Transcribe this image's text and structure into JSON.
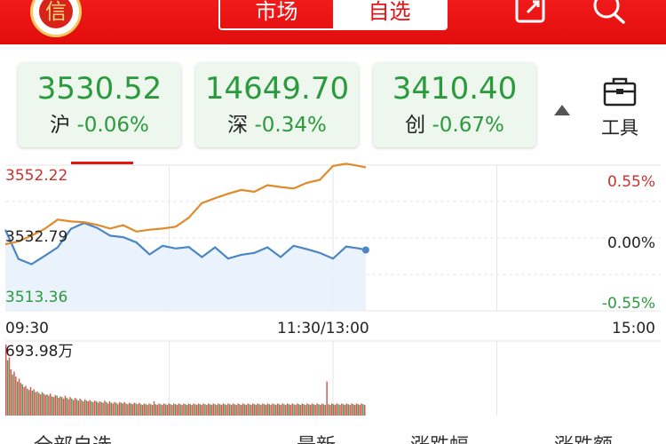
{
  "header": {
    "logo_text": "信",
    "tabs": [
      {
        "label": "市场",
        "active": false
      },
      {
        "label": "自选",
        "active": true
      }
    ],
    "icons": [
      "share-icon",
      "search-icon"
    ]
  },
  "indices": [
    {
      "value": "3530.52",
      "name": "沪",
      "change": "-0.06%"
    },
    {
      "value": "14649.70",
      "name": "深",
      "change": "-0.34%"
    },
    {
      "value": "3410.40",
      "name": "创",
      "change": "-0.67%"
    }
  ],
  "tools": {
    "label": "工具",
    "icon": "toolbox-icon"
  },
  "chart": {
    "y_left": {
      "top": "3552.22",
      "mid": "3532.79",
      "bottom": "3513.36"
    },
    "y_right": {
      "top": "0.55%",
      "mid": "0.00%",
      "bottom": "-0.55%"
    },
    "time_labels": {
      "start": "09:30",
      "mid": "11:30/13:00",
      "end": "15:00"
    },
    "volume_label": "693.98万"
  },
  "bottom_bar": [
    "全部自选",
    "最新",
    "涨跌幅",
    "涨跌额"
  ],
  "colors": {
    "brand_red": "#e31414",
    "up_red": "#c7332d",
    "down_green": "#2a9a3c",
    "index_line": "#4a86c5",
    "avg_line": "#e08a2a"
  },
  "chart_data": {
    "type": "line",
    "ylim": [
      3513.36,
      3552.22
    ],
    "x_progress": [
      0.0,
      0.02,
      0.04,
      0.06,
      0.08,
      0.1,
      0.12,
      0.14,
      0.16,
      0.18,
      0.2,
      0.22,
      0.24,
      0.26,
      0.28,
      0.3,
      0.32,
      0.34,
      0.36,
      0.38,
      0.4,
      0.42,
      0.44,
      0.46,
      0.48,
      0.5,
      0.52,
      0.54,
      0.55
    ],
    "series": [
      {
        "values": [
          3535.0,
          3527.2,
          3525.8,
          3528.0,
          3530.3,
          3535.2,
          3536.8,
          3535.5,
          3533.4,
          3533.0,
          3531.6,
          3528.4,
          3530.7,
          3530.0,
          3530.4,
          3527.7,
          3530.3,
          3527.3,
          3528.3,
          3528.8,
          3530.3,
          3527.7,
          3530.7,
          3529.8,
          3528.8,
          3527.3,
          3530.5,
          3530.0,
          3529.6
        ]
      },
      {
        "values": [
          3531.1,
          3531.9,
          3533.4,
          3535.2,
          3537.7,
          3537.2,
          3537.0,
          3536.3,
          3535.3,
          3536.2,
          3534.5,
          3535.0,
          3535.3,
          3535.8,
          3538.2,
          3542.1,
          3543.4,
          3544.6,
          3545.6,
          3545.1,
          3546.9,
          3546.4,
          3546.0,
          3547.5,
          3548.3,
          3552.0,
          3552.6,
          3552.0,
          3551.6
        ]
      }
    ],
    "volume": [
      1.0,
      0.78,
      0.82,
      0.65,
      0.58,
      0.62,
      0.55,
      0.48,
      0.52,
      0.46,
      0.44,
      0.4,
      0.42,
      0.38,
      0.36,
      0.4,
      0.35,
      0.37,
      0.33,
      0.34,
      0.32,
      0.3,
      0.33,
      0.31,
      0.29,
      0.3,
      0.28,
      0.31,
      0.27,
      0.26,
      0.29,
      0.28,
      0.25,
      0.27,
      0.26,
      0.24,
      0.28,
      0.25,
      0.23,
      0.26,
      0.24,
      0.22,
      0.25,
      0.23,
      0.21,
      0.24,
      0.22,
      0.2,
      0.23,
      0.21,
      0.2,
      0.22,
      0.2,
      0.19,
      0.21,
      0.2,
      0.18,
      0.2,
      0.19,
      0.18,
      0.21,
      0.19,
      0.17,
      0.2,
      0.18,
      0.17,
      0.19,
      0.18,
      0.16,
      0.19,
      0.18,
      0.17,
      0.19,
      0.17,
      0.16,
      0.18,
      0.17,
      0.16,
      0.18,
      0.17,
      0.16,
      0.18,
      0.16,
      0.15,
      0.17,
      0.16,
      0.15,
      0.17,
      0.16,
      0.15,
      0.2,
      0.16,
      0.15,
      0.17,
      0.16,
      0.15,
      0.17,
      0.16,
      0.15,
      0.17,
      0.16,
      0.15,
      0.17,
      0.16,
      0.15,
      0.17,
      0.16,
      0.15,
      0.17,
      0.16,
      0.15,
      0.17,
      0.16,
      0.15,
      0.17,
      0.16,
      0.15,
      0.17,
      0.16,
      0.15,
      0.17,
      0.16,
      0.15,
      0.17,
      0.16,
      0.15,
      0.17,
      0.16,
      0.15,
      0.17,
      0.16,
      0.15,
      0.17,
      0.16,
      0.15,
      0.17,
      0.16,
      0.15,
      0.17,
      0.16,
      0.15,
      0.17,
      0.16,
      0.15,
      0.17,
      0.16,
      0.15,
      0.17,
      0.16,
      0.15,
      0.17,
      0.16,
      0.15,
      0.17,
      0.16,
      0.15,
      0.17,
      0.16,
      0.15,
      0.17,
      0.16,
      0.15,
      0.17,
      0.16,
      0.15,
      0.17,
      0.16,
      0.15,
      0.17,
      0.16,
      0.15,
      0.17,
      0.16,
      0.15,
      0.17,
      0.16,
      0.15,
      0.17,
      0.16,
      0.15,
      0.17,
      0.16,
      0.15,
      0.17,
      0.16,
      0.15,
      0.17,
      0.16,
      0.15,
      0.17,
      0.16,
      0.15,
      0.17,
      0.16,
      0.15,
      0.48,
      0.16,
      0.15,
      0.17,
      0.16,
      0.15,
      0.17,
      0.16,
      0.15,
      0.17,
      0.16,
      0.15,
      0.17,
      0.16,
      0.15,
      0.17,
      0.16,
      0.15,
      0.17,
      0.16,
      0.15,
      0.17,
      0.16,
      0.15
    ]
  }
}
